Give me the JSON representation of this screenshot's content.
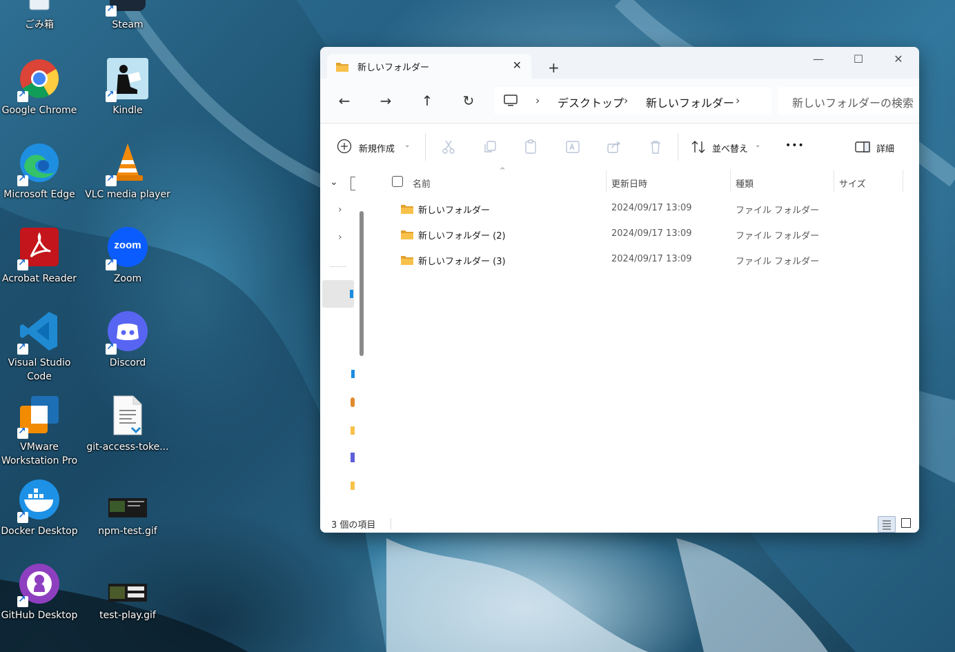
{
  "desktop": {
    "icons": [
      {
        "label": "ごみ箱",
        "icon": "recycle-bin-icon"
      },
      {
        "label": "Steam",
        "icon": "steam-icon"
      },
      {
        "label": "Google Chrome",
        "icon": "chrome-icon"
      },
      {
        "label": "Kindle",
        "icon": "kindle-icon"
      },
      {
        "label": "Microsoft Edge",
        "icon": "edge-icon"
      },
      {
        "label": "VLC media player",
        "icon": "vlc-icon"
      },
      {
        "label": "Acrobat Reader",
        "icon": "acrobat-icon"
      },
      {
        "label": "Zoom",
        "icon": "zoom-icon"
      },
      {
        "label": "Visual Studio Code",
        "icon": "vscode-icon"
      },
      {
        "label": "Discord",
        "icon": "discord-icon"
      },
      {
        "label": "VMware Workstation Pro",
        "icon": "vmware-icon"
      },
      {
        "label": "git-access-toke...",
        "icon": "text-file-icon"
      },
      {
        "label": "Docker Desktop",
        "icon": "docker-icon"
      },
      {
        "label": "npm-test.gif",
        "icon": "gif-file-icon"
      },
      {
        "label": "GitHub Desktop",
        "icon": "github-desktop-icon"
      },
      {
        "label": "test-play.gif",
        "icon": "gif-file-icon"
      }
    ],
    "zoom_logo_text": "zoom"
  },
  "explorer": {
    "tab_title": "新しいフォルダー",
    "tab_close": "✕",
    "new_tab": "+",
    "window_controls": {
      "minimize": "—",
      "maximize": "☐",
      "close": "✕"
    },
    "nav": {
      "back": "←",
      "forward": "→",
      "up": "↑",
      "refresh": "↻"
    },
    "breadcrumb": [
      "デスクトップ",
      "新しいフォルダー"
    ],
    "breadcrumb_sep": "›",
    "search_placeholder": "新しいフォルダーの検索",
    "toolbar": {
      "new": "新規作成",
      "sort": "並べ替え",
      "more": "•••",
      "details": "詳細"
    },
    "columns": {
      "name": "名前",
      "modified": "更新日時",
      "type": "種類",
      "size": "サイズ"
    },
    "files": [
      {
        "name": "新しいフォルダー",
        "modified": "2024/09/17 13:09",
        "type": "ファイル フォルダー"
      },
      {
        "name": "新しいフォルダー (2)",
        "modified": "2024/09/17 13:09",
        "type": "ファイル フォルダー"
      },
      {
        "name": "新しいフォルダー (3)",
        "modified": "2024/09/17 13:09",
        "type": "ファイル フォルダー"
      }
    ],
    "status": "3 個の項目"
  },
  "colors": {
    "accent": "#0067c0",
    "folder": "#f8c14a",
    "folder_dark": "#e0a22e"
  }
}
